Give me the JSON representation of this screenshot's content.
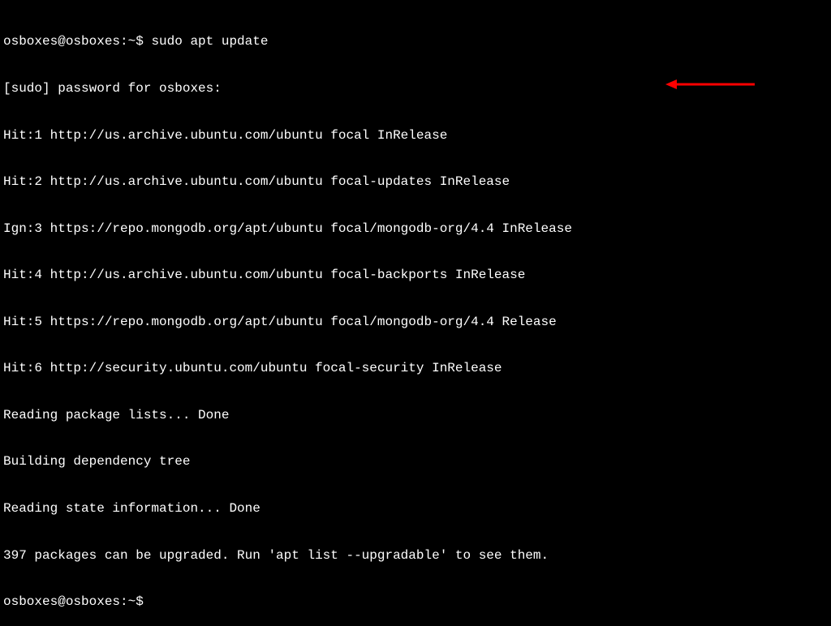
{
  "terminal": {
    "prompt1": "osboxes@osboxes:~$ ",
    "command1": "sudo apt update",
    "lines": [
      "[sudo] password for osboxes:",
      "Hit:1 http://us.archive.ubuntu.com/ubuntu focal InRelease",
      "Hit:2 http://us.archive.ubuntu.com/ubuntu focal-updates InRelease",
      "Ign:3 https://repo.mongodb.org/apt/ubuntu focal/mongodb-org/4.4 InRelease",
      "Hit:4 http://us.archive.ubuntu.com/ubuntu focal-backports InRelease",
      "Hit:5 https://repo.mongodb.org/apt/ubuntu focal/mongodb-org/4.4 Release",
      "Hit:6 http://security.ubuntu.com/ubuntu focal-security InRelease",
      "Reading package lists... Done",
      "Building dependency tree",
      "Reading state information... Done",
      "397 packages can be upgraded. Run 'apt list --upgradable' to see them."
    ],
    "prompt2": "osboxes@osboxes:~$ "
  },
  "annotation": {
    "target_line_index": 3,
    "color": "#ff0000"
  }
}
